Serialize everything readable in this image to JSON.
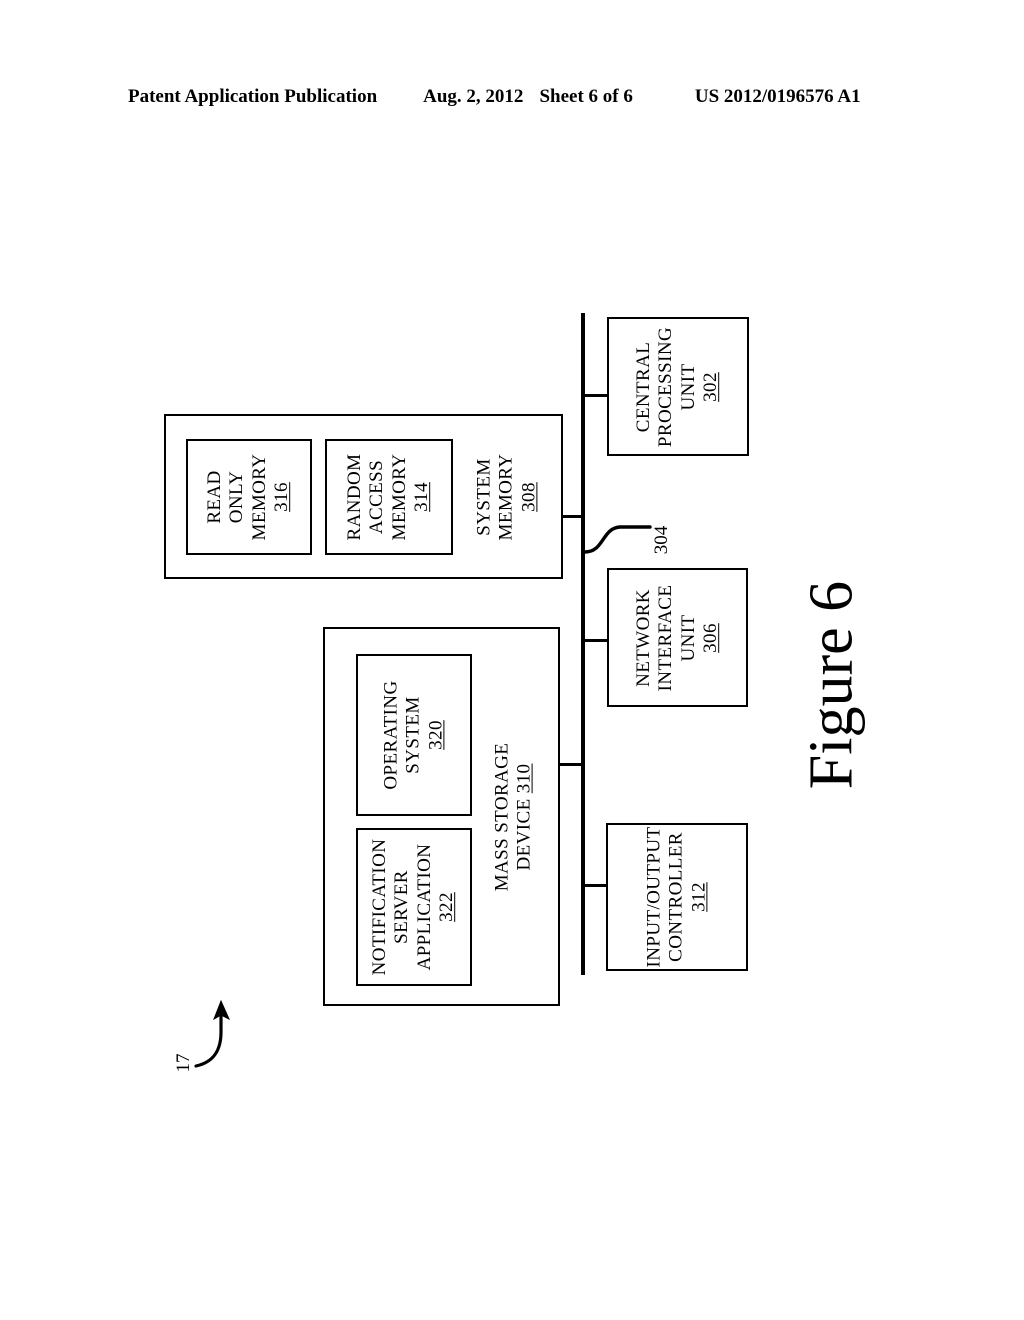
{
  "header": {
    "publication": "Patent Application Publication",
    "date": "Aug. 2, 2012",
    "sheet": "Sheet 6 of 6",
    "patent_number": "US 2012/0196576 A1"
  },
  "figure": {
    "caption": "Figure 6",
    "system_reference": "17",
    "bus_reference": "304"
  },
  "blocks": {
    "cpu": {
      "line1": "CENTRAL",
      "line2": "PROCESSING",
      "line3": "UNIT",
      "number": "302"
    },
    "network_interface_unit": {
      "line1": "NETWORK",
      "line2": "INTERFACE",
      "line3": "UNIT",
      "number": "306"
    },
    "input_output_controller": {
      "line1": "INPUT/OUTPUT",
      "line2": "CONTROLLER",
      "number": "312"
    },
    "system_memory": {
      "line1": "SYSTEM",
      "line2": "MEMORY",
      "number": "308"
    },
    "read_only_memory": {
      "line1": "READ",
      "line2": "ONLY",
      "line3": "MEMORY",
      "number": "316"
    },
    "random_access_memory": {
      "line1": "RANDOM",
      "line2": "ACCESS",
      "line3": "MEMORY",
      "number": "314"
    },
    "mass_storage_device": {
      "line1": "MASS STORAGE",
      "line2": "DEVICE",
      "number": "310"
    },
    "operating_system": {
      "line1": "OPERATING",
      "line2": "SYSTEM",
      "number": "320"
    },
    "notification_server_application": {
      "line1": "NOTIFICATION",
      "line2": "SERVER",
      "line3": "APPLICATION",
      "number": "322"
    }
  },
  "colors": {
    "ink": "#000000",
    "paper": "#ffffff"
  }
}
